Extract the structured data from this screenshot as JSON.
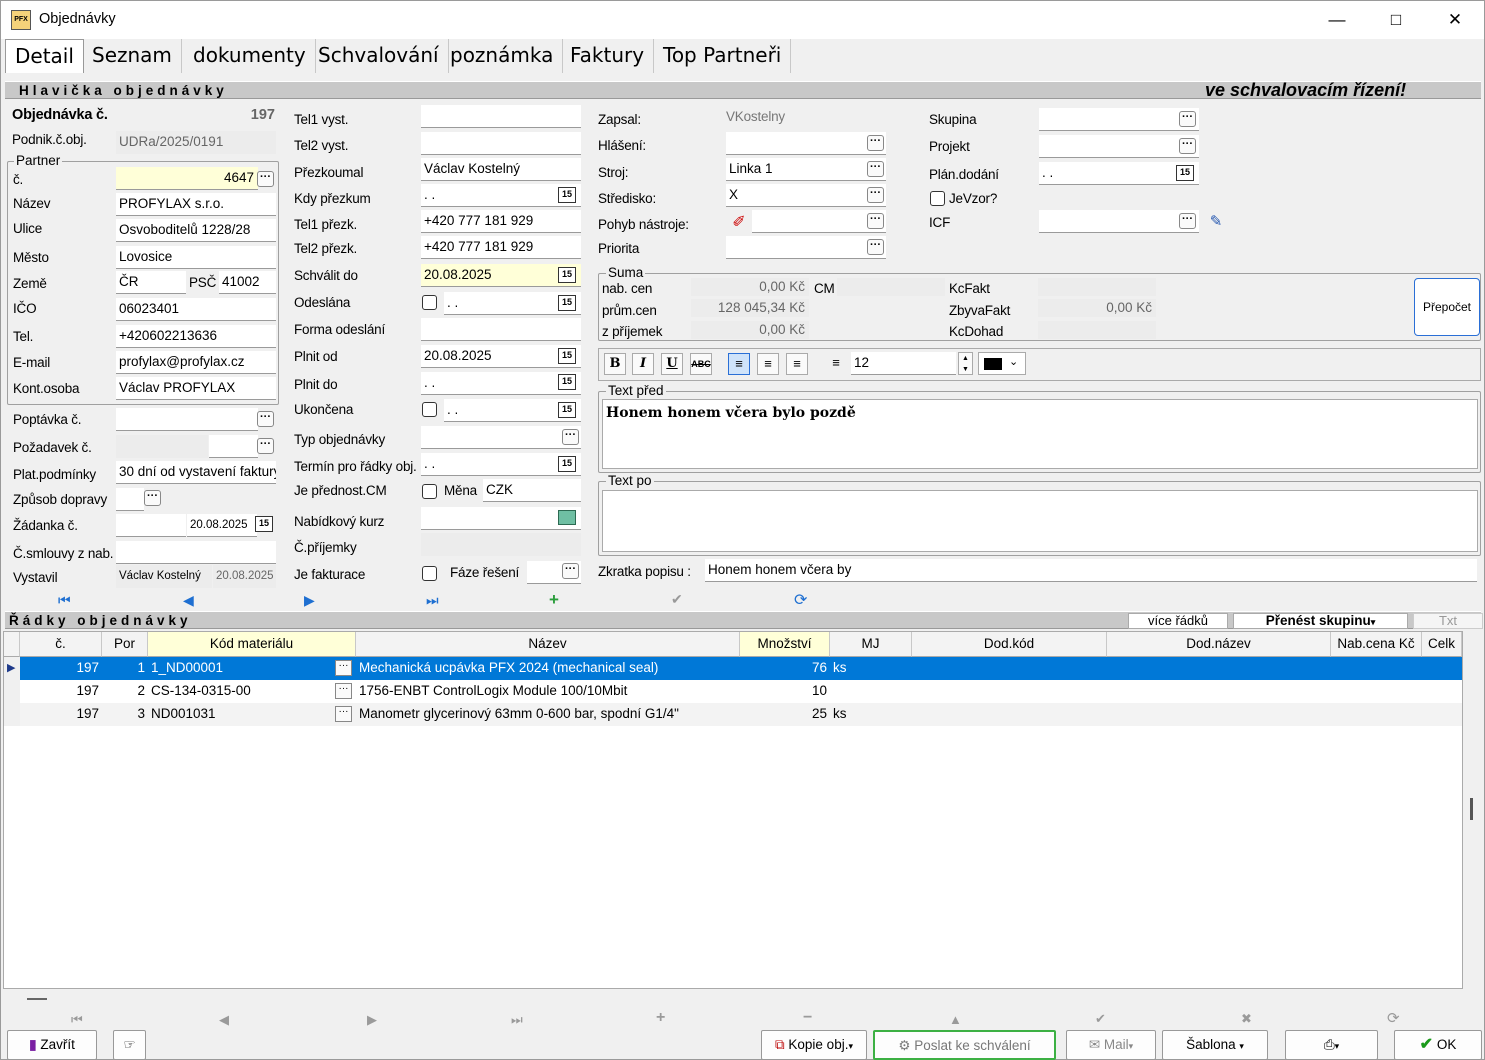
{
  "window": {
    "title": "Objednávky",
    "icon_text": "PFX"
  },
  "tabs": [
    "Detail",
    "Seznam",
    "dokumenty",
    "Schvalování",
    "poznámka",
    "Faktury",
    "Top Partneři"
  ],
  "header": {
    "title": "Hlavička objednávky",
    "status": "ve schvalovacím řízení!"
  },
  "col1": {
    "obj_label": "Objednávka č.",
    "obj_value": "197",
    "podnik_label": "Podnik.č.obj.",
    "podnik_value": "UDRa/2025/0191",
    "partner_group": "Partner",
    "c_label": "č.",
    "c_value": "4647",
    "nazev_label": "Název",
    "nazev_value": "PROFYLAX s.r.o.",
    "ulice_label": "Ulice",
    "ulice_value": "Osvoboditelů 1228/28",
    "mesto_label": "Město",
    "mesto_value": "Lovosice",
    "zeme_label": "Země",
    "zeme_value": "ČR",
    "psc_label": "PSČ",
    "psc_value": "41002",
    "ico_label": "IČO",
    "ico_value": "06023401",
    "tel_label": "Tel.",
    "tel_value": "+420602213636",
    "email_label": "E-mail",
    "email_value": "profylax@profylax.cz",
    "kont_label": "Kont.osoba",
    "kont_value": "Václav PROFYLAX",
    "poptavka_label": "Poptávka č.",
    "pozadavek_label": "Požadavek č.",
    "plat_label": "Plat.podmínky",
    "plat_value": "30 dní od vystavení faktury",
    "doprava_label": "Způsob dopravy",
    "zadanka_label": "Žádanka č.",
    "zadanka_date": "20.08.2025",
    "smlouvy_label": "Č.smlouvy z nab.",
    "vystavil_label": "Vystavil",
    "vystavil_value": "Václav Kostelný",
    "vystavil_date": "20.08.2025"
  },
  "col2": {
    "tel1_label": "Tel1 vyst.",
    "tel2_label": "Tel2 vyst.",
    "prezkoumal_label": "Přezkoumal",
    "prezkoumal_value": "Václav Kostelný",
    "kdy_label": "Kdy přezkum",
    "kdy_value": " .  .",
    "tel1p_label": "Tel1 přezk.",
    "tel1p_value": "+420 777 181 929",
    "tel2p_label": "Tel2 přezk.",
    "tel2p_value": "+420 777 181 929",
    "schvalit_label": "Schválit do",
    "schvalit_value": "20.08.2025",
    "odeslana_label": "Odeslána",
    "odeslana_value": " .  .",
    "forma_label": "Forma odeslání",
    "plnitod_label": "Plnit od",
    "plnitod_value": "20.08.2025",
    "plnitdo_label": "Plnit do",
    "plnitdo_value": " .  .",
    "ukoncena_label": "Ukončena",
    "ukoncena_value": " .  .",
    "typ_label": "Typ objednávky",
    "termin_label": "Termín pro řádky obj.",
    "termin_value": " .  .",
    "prednost_label": "Je přednost.CM",
    "mena_label": "Měna",
    "mena_value": "CZK",
    "kurz_label": "Nabídkový kurz",
    "prijemky_label": "Č.příjemky",
    "fakturace_label": "Je fakturace",
    "faze_label": "Fáze řešení"
  },
  "col3": {
    "zapsal_label": "Zapsal:",
    "zapsal_value": "VKostelny",
    "hlaseni_label": "Hlášení:",
    "stroj_label": "Stroj:",
    "stroj_value": "Linka 1",
    "stredisko_label": "Středisko:",
    "stredisko_value": "X",
    "pohyb_label": "Pohyb nástroje:",
    "priorita_label": "Priorita"
  },
  "col4": {
    "skupina_label": "Skupina",
    "projekt_label": "Projekt",
    "plan_label": "Plán.dodání",
    "plan_value": " .  .",
    "jevzor_label": "JeVzor?",
    "icf_label": "ICF"
  },
  "suma": {
    "title": "Suma",
    "nab_label": "nab. cen",
    "nab_value": "0,00 Kč",
    "cm_label": "CM",
    "prum_label": "prům.cen",
    "prum_value": "128 045,34 Kč",
    "prij_label": "z příjemek",
    "prij_value": "0,00 Kč",
    "kcfakt_label": "KcFakt",
    "zbyva_label": "ZbyvaFakt",
    "zbyva_value": "0,00 Kč",
    "kcdohad_label": "KcDohad",
    "prepocet_label": "Přepočet"
  },
  "editor": {
    "font_size": "12",
    "bold": "B",
    "italic": "I",
    "underline": "U",
    "strike": "ABC"
  },
  "text_pred": {
    "label": "Text před",
    "value": "Honem honem včera bylo pozdě"
  },
  "text_po": {
    "label": "Text po",
    "value": ""
  },
  "zkratka": {
    "label": "Zkratka popisu :",
    "value": "Honem honem včera by"
  },
  "rows_section": {
    "title": "Řádky objednávky",
    "more_rows": "více řádků",
    "transfer": "Přenést skupinu",
    "txt": "Txt"
  },
  "grid": {
    "columns": [
      "č.",
      "Por",
      "Kód materiálu",
      "Název",
      "Množství",
      "MJ",
      "Dod.kód",
      "Dod.název",
      "Nab.cena Kč",
      "Celk"
    ],
    "rows": [
      {
        "c": "197",
        "por": "1",
        "kod": "1_ND00001",
        "nazev": "Mechanická ucpávka PFX 2024 (mechanical seal)",
        "mnozstvi": "76",
        "mj": "ks"
      },
      {
        "c": "197",
        "por": "2",
        "kod": "CS-134-0315-00",
        "nazev": "1756-ENBT ControlLogix Module 100/10Mbit",
        "mnozstvi": "10",
        "mj": ""
      },
      {
        "c": "197",
        "por": "3",
        "kod": "ND001031",
        "nazev": "Manometr glycerinový 63mm 0-600 bar, spodní G1/4\"",
        "mnozstvi": "25",
        "mj": "ks"
      }
    ]
  },
  "footer": {
    "close": "Zavřít",
    "copy": "Kopie obj.",
    "send": "Poslat ke schválení",
    "mail": "Mail",
    "template": "Šablona",
    "ok": "OK"
  },
  "colors": {
    "selection": "#0078d7",
    "highlight": "#ffffd8",
    "nav_blue": "#1e6fd1",
    "nav_green": "#2a9d3b",
    "ok_green": "#1a9a1a"
  }
}
